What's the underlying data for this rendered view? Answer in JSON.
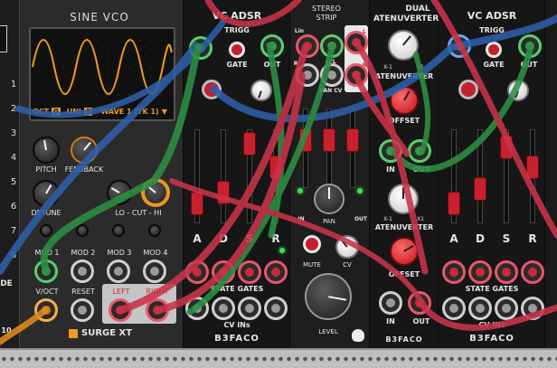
{
  "sine_vco": {
    "title": "SINE VCO",
    "oct_label": "OCT",
    "oct_value": "0",
    "uni_label": "UNI",
    "uni_value": "1",
    "wave_label": "WAVE 1 (TK 1)",
    "pitch": "PITCH",
    "feedback": "FEEDBACK",
    "detune": "DETUNE",
    "lo_cut_hi": "LO - CUT - HI",
    "mod1": "MOD 1",
    "mod2": "MOD 2",
    "mod3": "MOD 3",
    "mod4": "MOD 4",
    "voct": "V/OCT",
    "reset": "RESET",
    "left": "LEFT",
    "right": "RIGHT",
    "brand": "SURGE XT",
    "side_numbers": [
      "1",
      "2",
      "3",
      "4",
      "5",
      "6",
      "7",
      "8"
    ],
    "edge_de": "DE",
    "edge_10": "10"
  },
  "vc_adsr_1": {
    "title": "VC ADSR",
    "trigg": "TRIGG",
    "gate": "GATE",
    "out": "OUT",
    "a": "A",
    "d": "D",
    "s": "S",
    "r": "R",
    "state_gates": "STATE GATES",
    "cv_ins": "CV INs",
    "brand": "B3FACO"
  },
  "stereo_strip": {
    "title_1": "STEREO",
    "title_2": "STRIP",
    "lin": "Lin",
    "r": "R",
    "l_box": "L",
    "r_box": "R",
    "lvl": "LVL",
    "pan_cv": "PAN CV",
    "out": "OUT",
    "pan": "PAN",
    "mute": "MUTE",
    "cv": "CV",
    "level": "LEVEL",
    "in_label": "IN",
    "out_label": "OUT"
  },
  "dual_atenuverter": {
    "title_1": "DUAL",
    "title_2": "ATENUVERTER",
    "atenuverter": "ATENUVERTER",
    "offset": "OFFSET",
    "x_neg": "X-1",
    "x_pos": "X1",
    "in": "IN",
    "out": "OUT",
    "brand": "B3FACO"
  },
  "vc_adsr_2": {
    "title": "VC ADSR",
    "trigg": "TRIGG",
    "gate": "GATE",
    "out": "OUT",
    "a": "A",
    "d": "D",
    "s": "S",
    "r": "R",
    "state_gates": "STATE GATES",
    "cv_ins": "CV INs",
    "brand": "B3FACO"
  },
  "colors": {
    "cable_blue": "#2f5fa8",
    "cable_red": "#c9344a",
    "cable_green": "#2d8f43",
    "cable_orange": "#e08a1e",
    "vco_wave": "#f39a1f"
  }
}
